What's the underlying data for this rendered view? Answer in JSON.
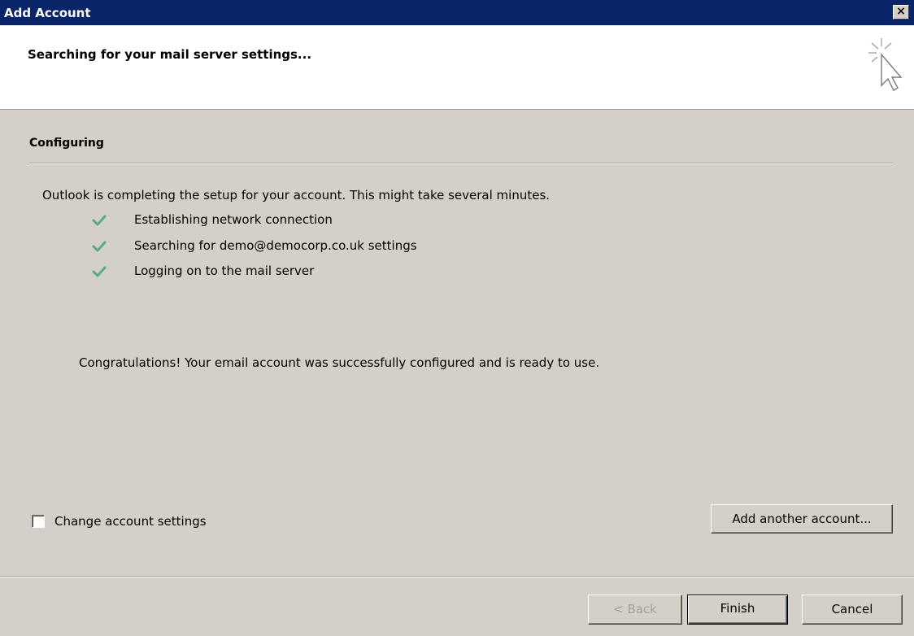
{
  "window": {
    "title": "Add Account",
    "close_label": "×"
  },
  "header": {
    "title": "Searching for your mail server settings...",
    "icon": "cursor-sparkle-icon"
  },
  "section": {
    "title": "Configuring",
    "intro": "Outlook is completing the setup for your account. This might take several minutes.",
    "steps": [
      {
        "label": "Establishing network connection",
        "status": "done"
      },
      {
        "label": "Searching for demo@democorp.co.uk settings",
        "status": "done"
      },
      {
        "label": "Logging on to the mail server",
        "status": "done"
      }
    ],
    "result": "Congratulations! Your email account was successfully configured and is ready to use."
  },
  "options": {
    "change_settings_label": "Change account settings",
    "change_settings_checked": false,
    "add_another_label": "Add another account..."
  },
  "footer": {
    "back_label": "< Back",
    "finish_label": "Finish",
    "cancel_label": "Cancel"
  },
  "colors": {
    "titlebar": "#0a246a",
    "check": "#5aa88e",
    "dialog_bg": "#d4d0c8"
  }
}
